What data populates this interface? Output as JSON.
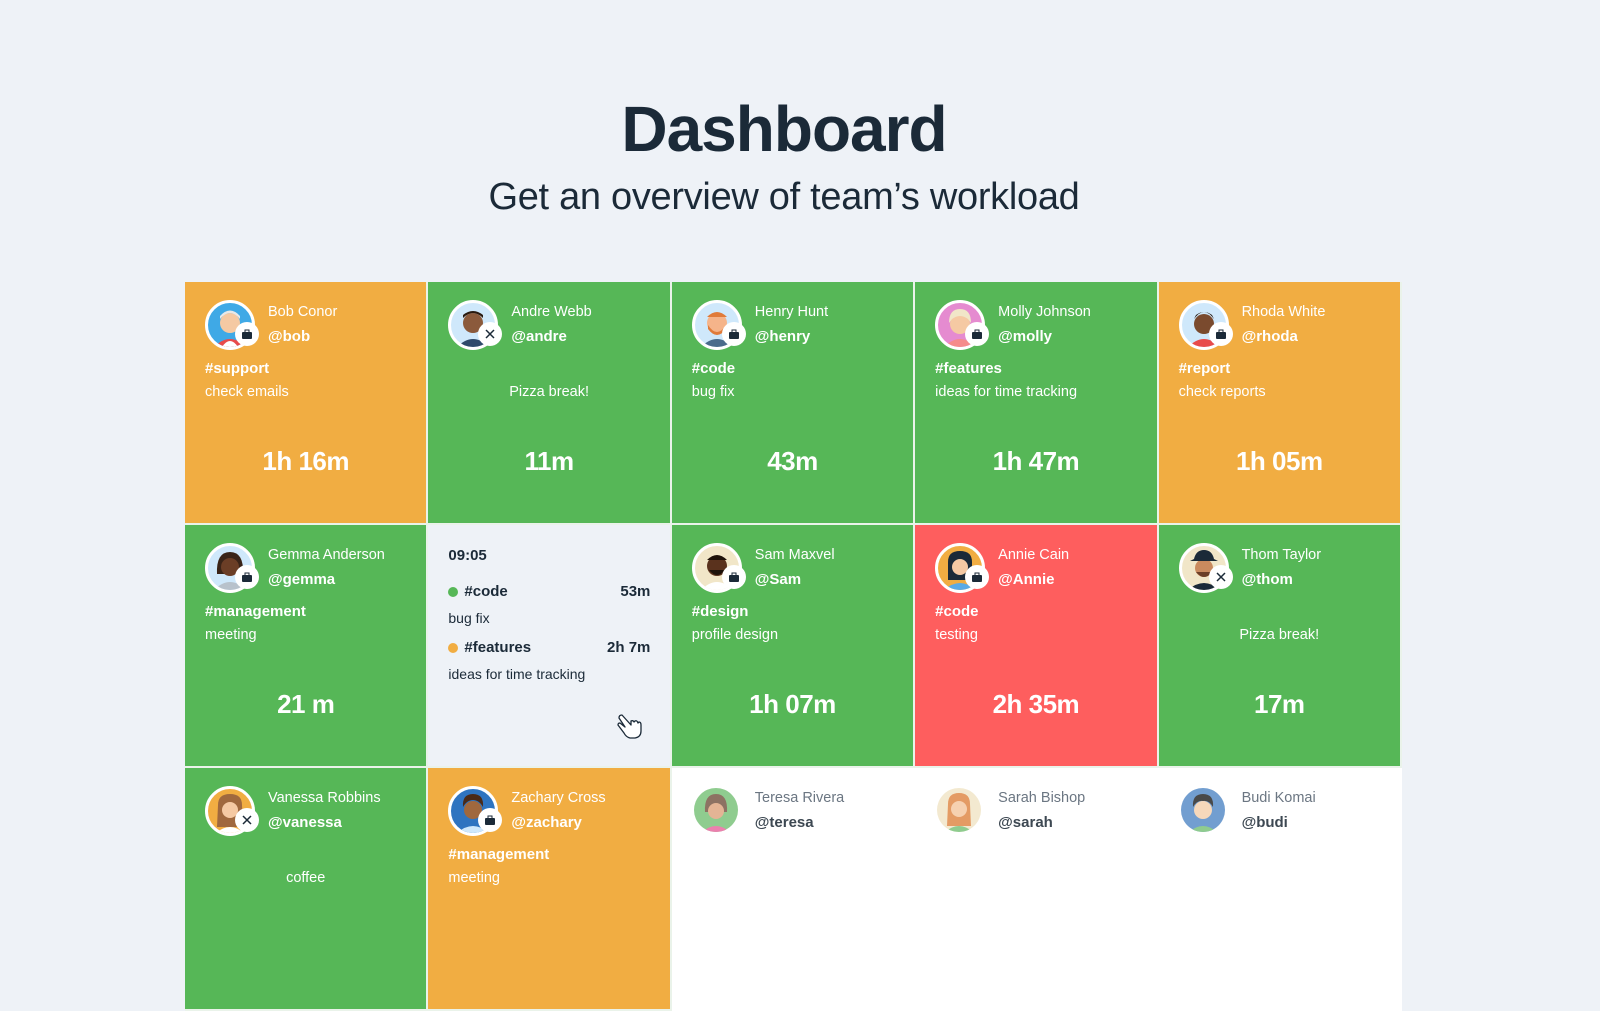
{
  "header": {
    "title": "Dashboard",
    "subtitle": "Get an overview of team’s workload"
  },
  "colors": {
    "working": "#56b757",
    "warning": "#f1ad42",
    "overtime": "#fe5e5e",
    "background": "#eef2f7",
    "text": "#1b2a38"
  },
  "cards": [
    {
      "name": "Bob Conor",
      "handle": "@bob",
      "tag": "#support",
      "task": "check emails",
      "time": "1h 16m",
      "status": "orange",
      "badge": "briefcase-icon"
    },
    {
      "name": "Andre Webb",
      "handle": "@andre",
      "tag": "",
      "task": "Pizza break!",
      "time": "11m",
      "status": "green",
      "badge": "utensils-icon"
    },
    {
      "name": "Henry Hunt",
      "handle": "@henry",
      "tag": "#code",
      "task": "bug fix",
      "time": "43m",
      "status": "green",
      "badge": "briefcase-icon"
    },
    {
      "name": "Molly Johnson",
      "handle": "@molly",
      "tag": "#features",
      "task": "ideas for time tracking",
      "time": "1h 47m",
      "status": "green",
      "badge": "briefcase-icon"
    },
    {
      "name": "Rhoda White",
      "handle": "@rhoda",
      "tag": "#report",
      "task": "check reports",
      "time": "1h 05m",
      "status": "orange",
      "badge": "briefcase-icon"
    },
    {
      "name": "Gemma Anderson",
      "handle": "@gemma",
      "tag": "#management",
      "task": "meeting",
      "time": "21 m",
      "status": "green",
      "badge": "briefcase-icon"
    },
    {
      "name": "Sam Maxvel",
      "handle": "@Sam",
      "tag": "#design",
      "task": "profile design",
      "time": "1h 07m",
      "status": "green",
      "badge": "briefcase-icon"
    },
    {
      "name": "Annie Cain",
      "handle": "@Annie",
      "tag": "#code",
      "task": "testing",
      "time": "2h 35m",
      "status": "red",
      "badge": "briefcase-icon"
    },
    {
      "name": "Thom Taylor",
      "handle": "@thom",
      "tag": "",
      "task": "Pizza break!",
      "time": "17m",
      "status": "green",
      "badge": "utensils-icon"
    },
    {
      "name": "Vanessa Robbins",
      "handle": "@vanessa",
      "tag": "",
      "task": "coffee",
      "time": "",
      "status": "green",
      "badge": "utensils-icon"
    },
    {
      "name": "Zachary Cross",
      "handle": "@zachary",
      "tag": "#management",
      "task": "meeting",
      "time": "",
      "status": "orange",
      "badge": "briefcase-icon"
    }
  ],
  "detail": {
    "start_time": "09:05",
    "entries": [
      {
        "tag": "#code",
        "task": "bug fix",
        "duration": "53m",
        "color": "#56b757"
      },
      {
        "tag": "#features",
        "task": "ideas for time tracking",
        "duration": "2h 7m",
        "color": "#f1ad42"
      }
    ]
  },
  "offline": [
    {
      "name": "Teresa Rivera",
      "handle": "@teresa"
    },
    {
      "name": "Sarah Bishop",
      "handle": "@sarah"
    },
    {
      "name": "Budi Komai",
      "handle": "@budi"
    }
  ]
}
